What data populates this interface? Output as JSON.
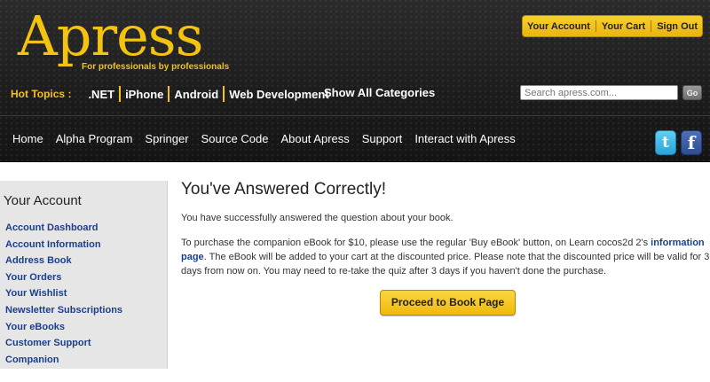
{
  "header": {
    "logo": "Apress",
    "tagline": "For professionals by professionals",
    "account_links": [
      "Your Account",
      "Your Cart",
      "Sign Out"
    ],
    "hot_topics_label": "Hot Topics :",
    "hot_topics": [
      ".NET",
      "iPhone",
      "Android",
      "Web Development"
    ],
    "show_all": "Show All Categories",
    "search_placeholder": "Search apress.com...",
    "search_button": "Go"
  },
  "nav": {
    "items": [
      "Home",
      "Alpha Program",
      "Springer",
      "Source Code",
      "About Apress",
      "Support",
      "Interact with Apress"
    ]
  },
  "social": {
    "twitter": "t",
    "facebook": "f"
  },
  "sidebar": {
    "title": "Your Account",
    "items": [
      "Account Dashboard",
      "Account Information",
      "Address Book",
      "Your Orders",
      "Your Wishlist",
      "Newsletter Subscriptions",
      "Your eBooks",
      "Customer Support",
      "Companion"
    ]
  },
  "main": {
    "title": "You've Answered Correctly!",
    "p1": "You have successfully answered the question about your book.",
    "p2_before": "To purchase the companion eBook for $10, please use the regular 'Buy eBook' button, on Learn cocos2d 2's ",
    "p2_link": "information page",
    "p2_after": ". The eBook will be added to your cart at the discounted price. Please note that the discounted price will be valid for 3 days from now on. You may need to re-take the quiz after 3 days if you haven't done the purchase.",
    "button": "Proceed to Book Page"
  },
  "colors": {
    "accent": "#f4c211",
    "link": "#1c3f8c"
  }
}
